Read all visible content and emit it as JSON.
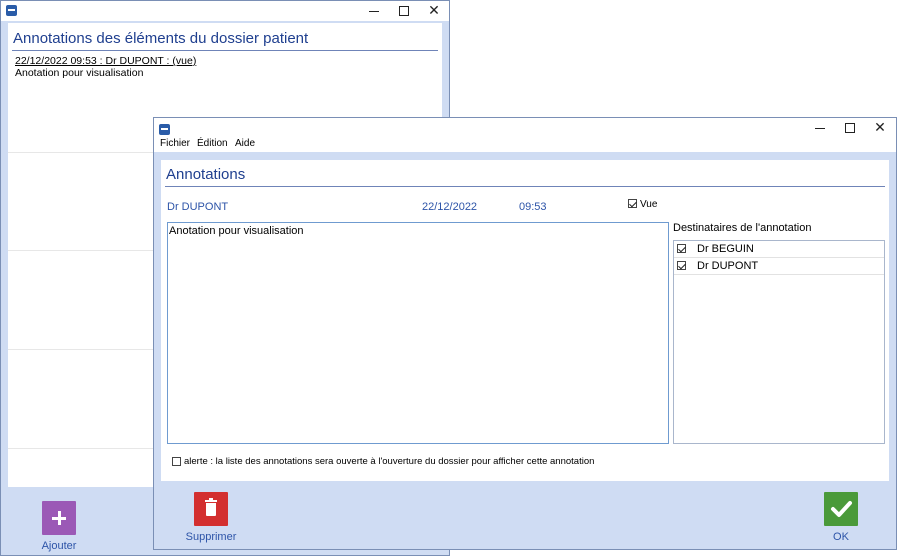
{
  "back_window": {
    "heading": "Annotations des éléments du dossier patient",
    "entry_header": "22/12/2022 09:53 : Dr DUPONT : (vue)",
    "entry_text": "Anotation pour visualisation",
    "add_label": "Ajouter",
    "add_icon": "plus-icon",
    "add_color": "#9b59b6"
  },
  "front_window": {
    "menu": [
      "Fichier",
      "Édition",
      "Aide"
    ],
    "heading": "Annotations",
    "author": "Dr DUPONT",
    "date": "22/12/2022",
    "time": "09:53",
    "vue_label": "Vue",
    "vue_checked": true,
    "annotation_text": "Anotation pour visualisation",
    "recipients_label": "Destinataires de l'annotation",
    "recipients": [
      {
        "name": "Dr BEGUIN",
        "checked": true
      },
      {
        "name": "Dr DUPONT",
        "checked": true
      }
    ],
    "alert_label": "alerte : la liste des annotations sera ouverte à l'ouverture du dossier pour afficher cette annotation",
    "alert_checked": false,
    "delete_label": "Supprimer",
    "delete_icon": "trash-icon",
    "delete_color": "#d32f2f",
    "ok_label": "OK",
    "ok_icon": "check-icon",
    "ok_color": "#4a9a3a"
  },
  "window_controls": {
    "minimize": "minimize-icon",
    "maximize": "maximize-icon",
    "close": "close-icon",
    "close_glyph": "✕"
  }
}
